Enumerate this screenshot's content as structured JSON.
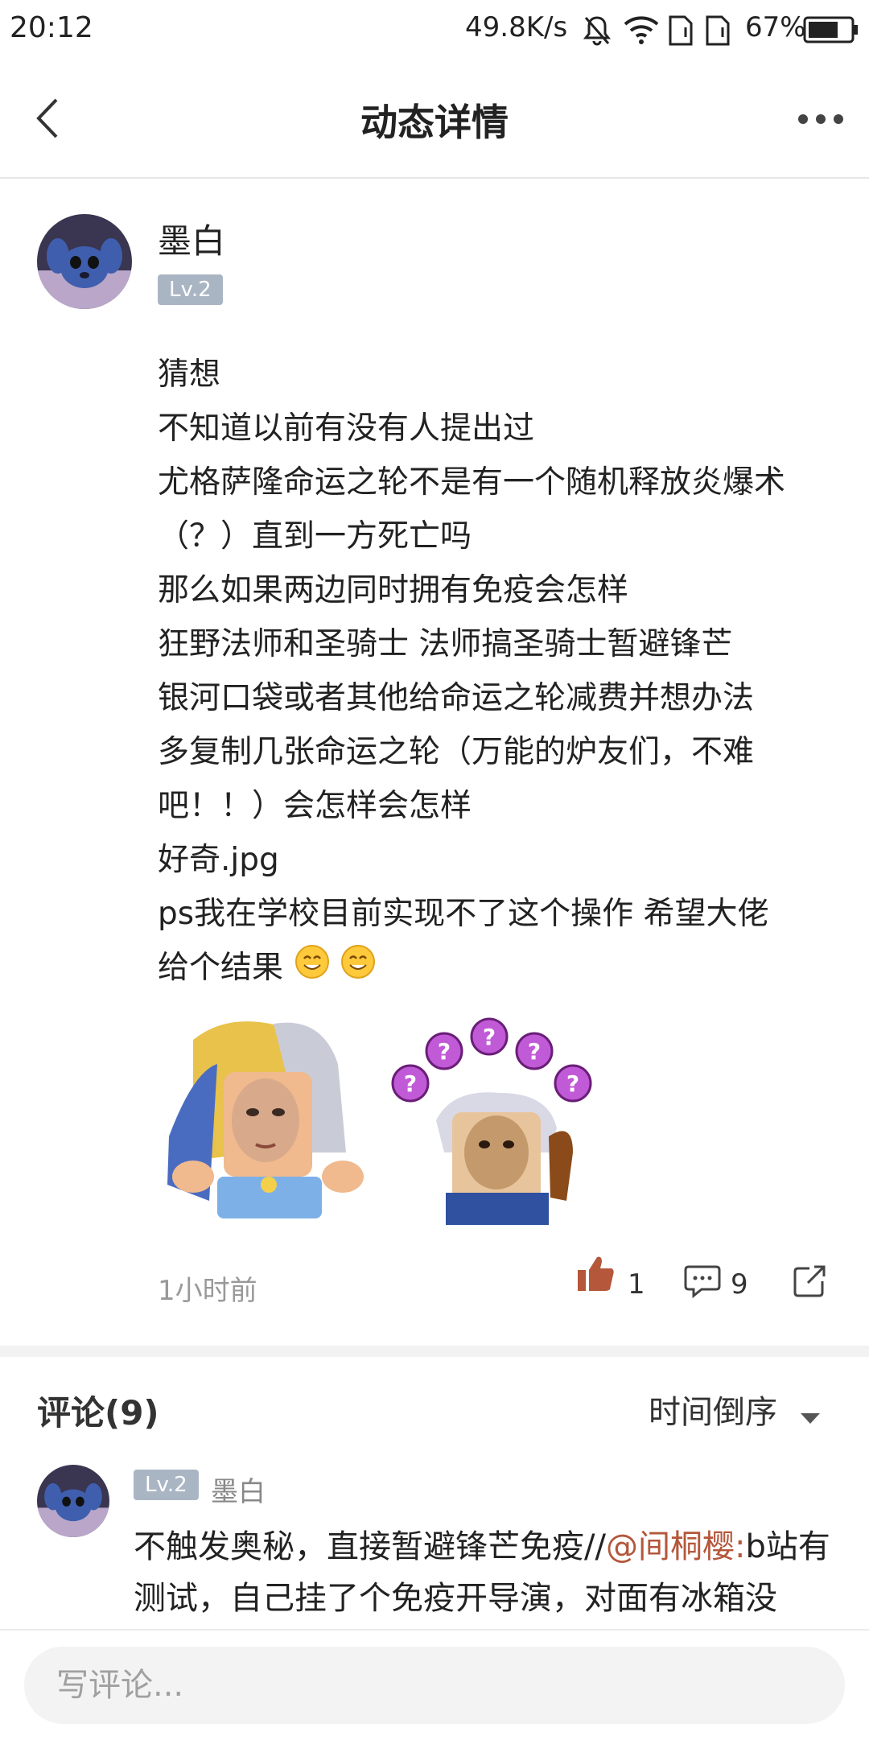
{
  "status_bar": {
    "time": "20:12",
    "network_speed": "49.8K/s",
    "battery": "67%"
  },
  "header": {
    "title": "动态详情"
  },
  "post": {
    "author": "墨白",
    "level": "Lv.2",
    "lines": [
      "猜想",
      "不知道以前有没有人提出过",
      "尤格萨隆命运之轮不是有一个随机释放炎爆术",
      "（？）直到一方死亡吗",
      "那么如果两边同时拥有免疫会怎样",
      "狂野法师和圣骑士 法师搞圣骑士暂避锋芒",
      "银河口袋或者其他给命运之轮减费并想办法",
      "多复制几张命运之轮（万能的炉友们，不难",
      "吧！！）会怎样会怎样",
      "好奇.jpg",
      "ps我在学校目前实现不了这个操作 希望大佬",
      "给个结果"
    ],
    "time_ago": "1小时前",
    "likes": "1",
    "comments": "9"
  },
  "comments_section": {
    "title": "评论(9)",
    "sort_label": "时间倒序"
  },
  "comment": {
    "level": "Lv.2",
    "author": "墨白",
    "text_before": "不触发奥秘，直接暂避锋芒免疫//",
    "mention": "@间桐樱:",
    "text_after": "b站有测试，自己挂了个免疫开导演，对面有冰箱没"
  },
  "input": {
    "placeholder": "写评论..."
  },
  "colors": {
    "accent_mention": "#b4573b",
    "like_icon": "#b4573b",
    "level_badge": "#aab5c4"
  }
}
